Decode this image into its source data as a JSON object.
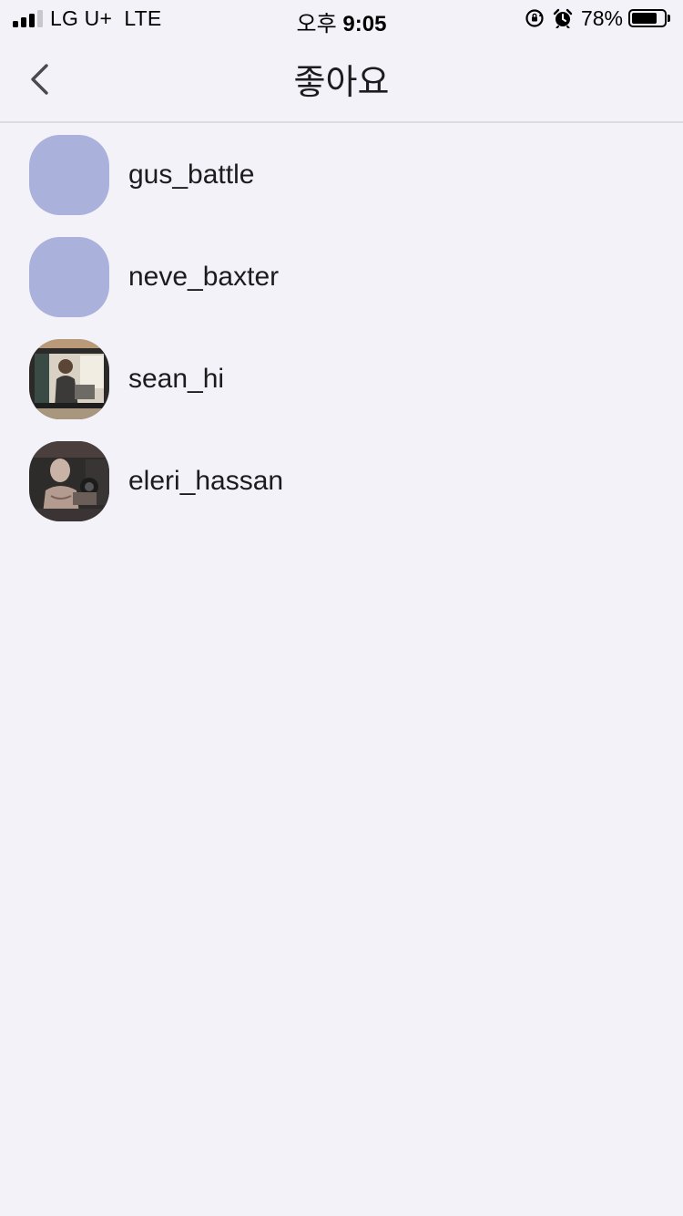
{
  "status_bar": {
    "carrier": "LG U+",
    "network": "LTE",
    "time_prefix": "오후",
    "time": "9:05",
    "battery_percent": "78%",
    "battery_level": 0.78,
    "signal_icon": "cellular-signal-icon",
    "orientation_lock_icon": "orientation-lock-icon",
    "alarm_icon": "alarm-clock-icon"
  },
  "nav": {
    "title": "좋아요",
    "back_icon": "chevron-left-icon"
  },
  "likes": [
    {
      "username": "gus_battle",
      "avatar": "placeholder"
    },
    {
      "username": "neve_baxter",
      "avatar": "placeholder"
    },
    {
      "username": "sean_hi",
      "avatar": "photo"
    },
    {
      "username": "eleri_hassan",
      "avatar": "photo"
    }
  ],
  "colors": {
    "background": "#f3f2f8",
    "avatar_placeholder": "#aab2dc",
    "text_primary": "#1c1c1e",
    "divider": "#dcdce0"
  }
}
